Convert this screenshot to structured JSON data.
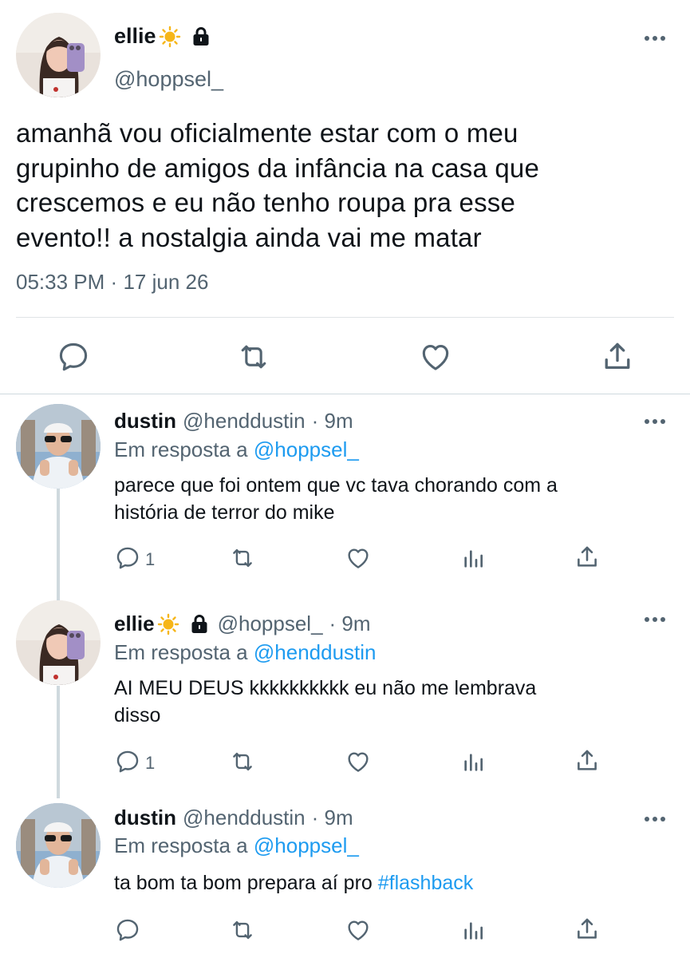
{
  "main_tweet": {
    "name": "ellie",
    "handle": "@hoppsel_",
    "text_lines": [
      "amanhã vou oficialmente estar com o meu",
      "grupinho de amigos da infância na casa que",
      "crescemos e eu não tenho roupa pra esse",
      "evento!! a nostalgia ainda vai me matar"
    ],
    "time": "05:33 PM",
    "date_sep": "·",
    "date": "17 jun 26"
  },
  "replies": [
    {
      "name": "dustin",
      "handle": "@henddustin",
      "time": "· 9m",
      "in_reply_prefix": "Em resposta a",
      "in_reply_to": "@hoppsel_",
      "text_lines": [
        "parece que foi ontem que vc tava chorando com a",
        "história de terror do mike"
      ],
      "reply_count": "1"
    },
    {
      "name": "ellie",
      "handle": "@hoppsel_",
      "time": "· 9m",
      "in_reply_prefix": "Em resposta a",
      "in_reply_to": "@henddustin",
      "text_lines": [
        "AI MEU DEUS kkkkkkkkkk eu não me lembrava",
        "disso"
      ],
      "reply_count": "1"
    },
    {
      "name": "dustin",
      "handle": "@henddustin",
      "time": "· 9m",
      "in_reply_prefix": "Em resposta a",
      "in_reply_to": "@hoppsel_",
      "text_prefix": "ta bom ta bom prepara aí pro ",
      "hashtag": "#flashback",
      "reply_count": ""
    }
  ],
  "colors": {
    "text": "#0f1419",
    "secondary": "#536471",
    "link": "#1d9bf0",
    "divider": "#cfd9de"
  },
  "icons": [
    "reply-icon",
    "retweet-icon",
    "like-icon",
    "share-icon",
    "views-icon",
    "more-icon",
    "sun-emoji-icon",
    "lock-icon"
  ]
}
